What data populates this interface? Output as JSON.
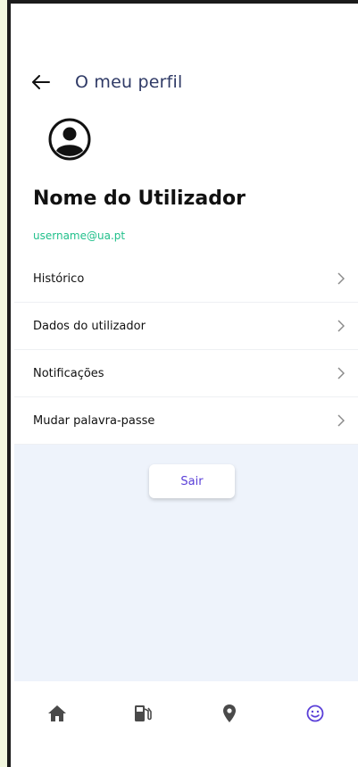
{
  "header": {
    "title": "O meu perfil",
    "back_icon": "arrow-left-icon"
  },
  "profile": {
    "avatar_icon": "user-avatar-icon",
    "name": "Nome do Utilizador",
    "email": "username@ua.pt"
  },
  "menu": {
    "items": [
      {
        "label": "Histórico"
      },
      {
        "label": "Dados do utilizador"
      },
      {
        "label": "Notificações"
      },
      {
        "label": "Mudar palavra-passe"
      }
    ]
  },
  "actions": {
    "logout_label": "Sair"
  },
  "bottom_nav": {
    "items": [
      "home-icon",
      "fuel-pump-icon",
      "location-pin-icon",
      "smiley-icon"
    ],
    "active": "smiley-icon"
  },
  "colors": {
    "title": "#2f3a66",
    "email": "#21c08b",
    "accent": "#5a3fd8",
    "nav_inactive": "#4a4a4a",
    "panel_bg": "#eef3fb"
  }
}
